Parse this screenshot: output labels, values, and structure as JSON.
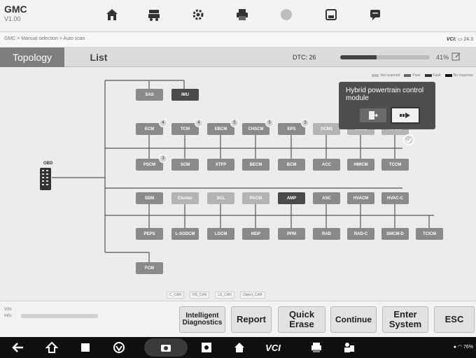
{
  "header": {
    "title": "GMC",
    "version": "V1.00"
  },
  "breadcrumb": "GMC > Manual selection > Auto scan",
  "vci": {
    "label": "VCI:",
    "value": "24.3"
  },
  "tabs": {
    "topology": "Topology",
    "list": "List"
  },
  "dtc": {
    "label": "DTC: 26"
  },
  "progress": {
    "value": 41,
    "text": "41%"
  },
  "legend": [
    "Not scanned",
    "Pass",
    "Fault",
    "No response"
  ],
  "obd_label": "OBD",
  "rows": [
    [
      {
        "label": "SAS",
        "kind": "fault"
      },
      {
        "label": "IMU",
        "kind": "dark"
      }
    ],
    [
      {
        "label": "ECM",
        "kind": "fault",
        "badge": "4"
      },
      {
        "label": "TCM",
        "kind": "fault",
        "badge": "4"
      },
      {
        "label": "EBCM",
        "kind": "fault",
        "badge": "5"
      },
      {
        "label": "CHSCM",
        "kind": "fault",
        "badge": "5"
      },
      {
        "label": "EPS",
        "kind": "fault",
        "badge": "3"
      },
      {
        "label": "OCM1",
        "kind": "light"
      },
      {
        "label": "OCM2",
        "kind": "light"
      },
      {
        "label": "HPCM",
        "kind": "light"
      }
    ],
    [
      {
        "label": "PSCM",
        "kind": "fault",
        "badge": "3"
      },
      {
        "label": "SCM",
        "kind": "fault"
      },
      {
        "label": "XTFP",
        "kind": "fault"
      },
      {
        "label": "BECM",
        "kind": "fault"
      },
      {
        "label": "BCM",
        "kind": "fault"
      },
      {
        "label": "ACC",
        "kind": "fault"
      },
      {
        "label": "HMICM",
        "kind": "fault"
      },
      {
        "label": "TCCM",
        "kind": "fault"
      }
    ],
    [
      {
        "label": "SDM",
        "kind": "fault"
      },
      {
        "label": "Cluster",
        "kind": "light"
      },
      {
        "label": "SCL",
        "kind": "light"
      },
      {
        "label": "PACM",
        "kind": "light"
      },
      {
        "label": "AMP",
        "kind": "dark"
      },
      {
        "label": "ASC",
        "kind": "fault"
      },
      {
        "label": "HVACM",
        "kind": "fault"
      },
      {
        "label": "HVAC-C",
        "kind": "fault"
      }
    ],
    [
      {
        "label": "PEPS",
        "kind": "fault"
      },
      {
        "label": "L-SODCM",
        "kind": "fault"
      },
      {
        "label": "LGCM",
        "kind": "fault"
      },
      {
        "label": "MDP",
        "kind": "fault"
      },
      {
        "label": "PPM",
        "kind": "fault"
      },
      {
        "label": "RAD",
        "kind": "fault"
      },
      {
        "label": "RAD-C",
        "kind": "fault"
      },
      {
        "label": "SMCM-D",
        "kind": "fault"
      },
      {
        "label": "TCICM",
        "kind": "fault"
      }
    ],
    [
      {
        "label": "FCM",
        "kind": "fault"
      }
    ]
  ],
  "bus_legend": [
    "C_CAN",
    "HS_CAN",
    "LS_CAN",
    "Object_CAN"
  ],
  "tooltip": {
    "text": "Hybrid powertrain control module"
  },
  "vin": {
    "line1": "VIN:",
    "line2": "Info:"
  },
  "actions": [
    {
      "label": "Intelligent\nDiagnostics",
      "name": "intelligent-diagnostics-button"
    },
    {
      "label": "Report",
      "name": "report-button"
    },
    {
      "label": "Quick\nErase",
      "name": "quick-erase-button"
    },
    {
      "label": "Continue",
      "name": "continue-button"
    },
    {
      "label": "Enter\nSystem",
      "name": "enter-system-button"
    },
    {
      "label": "ESC",
      "name": "esc-button"
    }
  ],
  "status": "76%",
  "colors": {
    "fault": "#8a8a8a",
    "dark": "#4a4a4a",
    "light": "#b4b4b4",
    "tab_active": "#7e7e7e"
  },
  "icons": {
    "toolbar": [
      "home-icon",
      "vehicle-icon",
      "settings-icon",
      "print-icon",
      "help-icon",
      "save-icon",
      "chat-icon"
    ],
    "nav": [
      "back-icon",
      "home-icon",
      "recent-apps-icon",
      "browser-icon",
      "camera-icon",
      "brightness-icon",
      "home-app-icon",
      "vci-icon",
      "printer-icon",
      "remote-support-icon"
    ]
  }
}
